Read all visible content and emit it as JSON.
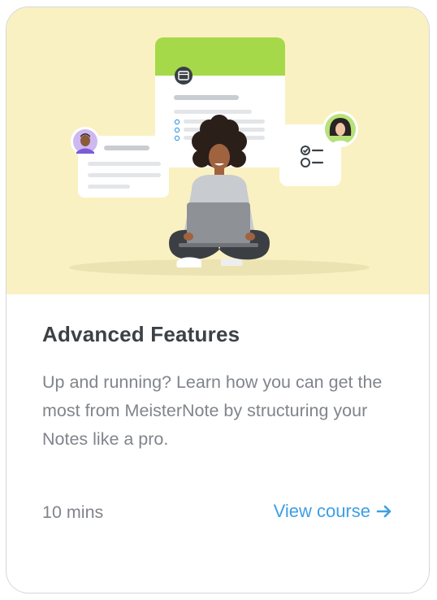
{
  "card": {
    "title": "Advanced Features",
    "description": "Up and running? Learn how you can get the most from MeisterNote by structuring your Notes like a pro.",
    "duration": "10 mins",
    "cta_label": "View course"
  },
  "colors": {
    "hero_background": "#faf1c2",
    "accent_green": "#a6d949",
    "link_blue": "#3d9fe6",
    "title_text": "#3c4146",
    "body_text": "#80858b"
  },
  "icons": [
    "calendar-icon",
    "checklist-icon",
    "arrow-right-icon"
  ]
}
